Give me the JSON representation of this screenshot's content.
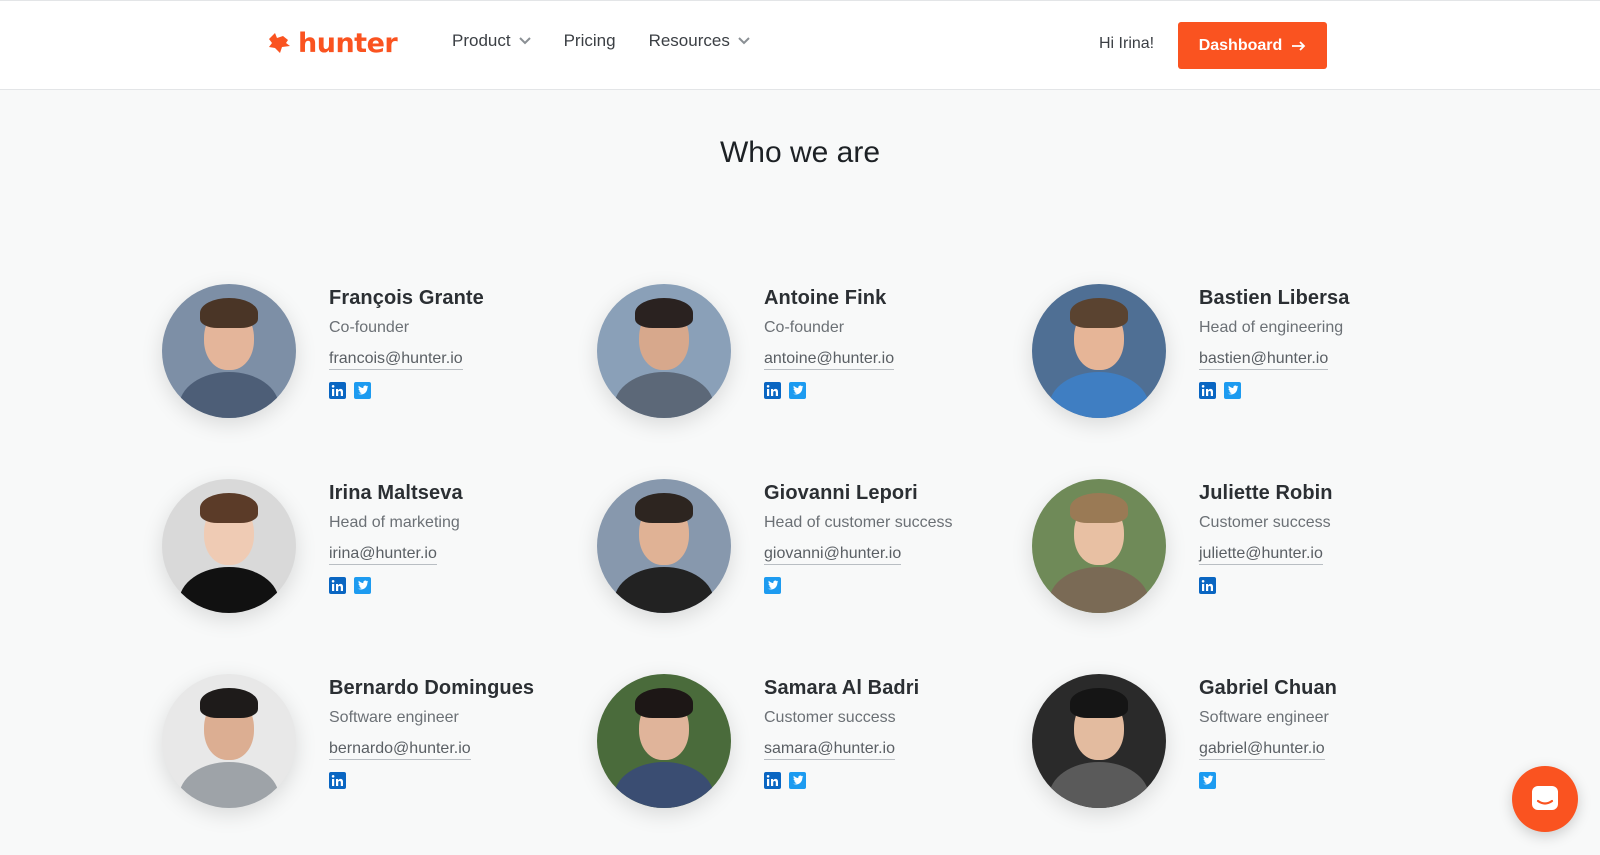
{
  "header": {
    "logo_text": "hunter",
    "nav": [
      {
        "label": "Product",
        "has_dropdown": true
      },
      {
        "label": "Pricing",
        "has_dropdown": false
      },
      {
        "label": "Resources",
        "has_dropdown": true
      }
    ],
    "greeting": "Hi Irina!",
    "dashboard_label": "Dashboard"
  },
  "section_title": "Who we are",
  "team": [
    {
      "name": "François Grante",
      "role": "Co-founder",
      "email": "francois@hunter.io",
      "linkedin": true,
      "twitter": true
    },
    {
      "name": "Antoine Fink",
      "role": "Co-founder",
      "email": "antoine@hunter.io",
      "linkedin": true,
      "twitter": true
    },
    {
      "name": "Bastien Libersa",
      "role": "Head of engineering",
      "email": "bastien@hunter.io",
      "linkedin": true,
      "twitter": true
    },
    {
      "name": "Irina Maltseva",
      "role": "Head of marketing",
      "email": "irina@hunter.io",
      "linkedin": true,
      "twitter": true
    },
    {
      "name": "Giovanni Lepori",
      "role": "Head of customer success",
      "email": "giovanni@hunter.io",
      "linkedin": false,
      "twitter": true
    },
    {
      "name": "Juliette Robin",
      "role": "Customer success",
      "email": "juliette@hunter.io",
      "linkedin": true,
      "twitter": false
    },
    {
      "name": "Bernardo Domingues",
      "role": "Software engineer",
      "email": "bernardo@hunter.io",
      "linkedin": true,
      "twitter": false
    },
    {
      "name": "Samara Al Badri",
      "role": "Customer success",
      "email": "samara@hunter.io",
      "linkedin": true,
      "twitter": true
    },
    {
      "name": "Gabriel Chuan",
      "role": "Software engineer",
      "email": "gabriel@hunter.io",
      "linkedin": false,
      "twitter": true
    }
  ],
  "colors": {
    "brand": "#fa5320",
    "linkedin": "#0a66c2",
    "twitter": "#1d9bf0"
  },
  "icons": {
    "logo": "fox-logo-icon",
    "dropdown": "chevron-down-icon",
    "dashboard": "arrow-right-icon",
    "linkedin": "linkedin-icon",
    "twitter": "twitter-icon",
    "chat": "chat-launcher-icon"
  }
}
